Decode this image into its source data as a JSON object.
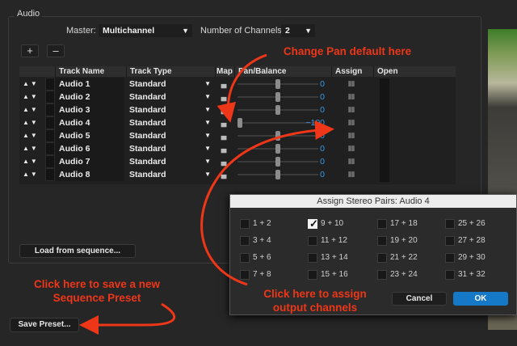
{
  "audio_section": {
    "title": "Audio"
  },
  "master": {
    "label": "Master:",
    "value": "Multichannel"
  },
  "channels": {
    "label": "Number of Channels:",
    "value": "2"
  },
  "add_button": "+",
  "remove_button": "–",
  "table": {
    "headers": [
      "Track Name",
      "Track Type",
      "Map",
      "Pan/Balance",
      "Assign",
      "Open"
    ],
    "rows": [
      {
        "name": "Audio 1",
        "type": "Standard",
        "pan": "0",
        "pan_pos": 0.5
      },
      {
        "name": "Audio 2",
        "type": "Standard",
        "pan": "0",
        "pan_pos": 0.5
      },
      {
        "name": "Audio 3",
        "type": "Standard",
        "pan": "0",
        "pan_pos": 0.5
      },
      {
        "name": "Audio 4",
        "type": "Standard",
        "pan": "−100",
        "pan_pos": 0.0
      },
      {
        "name": "Audio 5",
        "type": "Standard",
        "pan": "0",
        "pan_pos": 0.5
      },
      {
        "name": "Audio 6",
        "type": "Standard",
        "pan": "0",
        "pan_pos": 0.5
      },
      {
        "name": "Audio 7",
        "type": "Standard",
        "pan": "0",
        "pan_pos": 0.5
      },
      {
        "name": "Audio 8",
        "type": "Standard",
        "pan": "0",
        "pan_pos": 0.5
      }
    ]
  },
  "load_button": "Load from sequence...",
  "save_button": "Save Preset...",
  "annotations": {
    "pan": "Change Pan default here",
    "save_line1": "Click here to save a new",
    "save_line2": "Sequence Preset",
    "assign_line1": "Click here to assign",
    "assign_line2": "output channels"
  },
  "dialog": {
    "title": "Assign Stereo Pairs: Audio 4",
    "pairs": [
      {
        "label": "1 + 2",
        "checked": false
      },
      {
        "label": "9 + 10",
        "checked": true
      },
      {
        "label": "17 + 18",
        "checked": false
      },
      {
        "label": "25 + 26",
        "checked": false
      },
      {
        "label": "3 + 4",
        "checked": false
      },
      {
        "label": "11 + 12",
        "checked": false
      },
      {
        "label": "19 + 20",
        "checked": false
      },
      {
        "label": "27 + 28",
        "checked": false
      },
      {
        "label": "5 + 6",
        "checked": false
      },
      {
        "label": "13 + 14",
        "checked": false
      },
      {
        "label": "21 + 22",
        "checked": false
      },
      {
        "label": "29 + 30",
        "checked": false
      },
      {
        "label": "7 + 8",
        "checked": false
      },
      {
        "label": "15 + 16",
        "checked": false
      },
      {
        "label": "23 + 24",
        "checked": false
      },
      {
        "label": "31 + 32",
        "checked": false
      }
    ],
    "cancel": "Cancel",
    "ok": "OK"
  },
  "colors": {
    "annotation": "#ee3618",
    "ok_button": "#1679c8",
    "pan_value": "#3a98e8"
  }
}
